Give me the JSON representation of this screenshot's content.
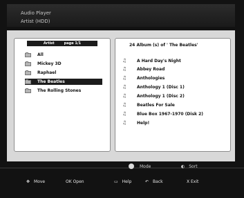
{
  "header": {
    "app_title": "Audio Player",
    "subtitle": "Artist (HDD)"
  },
  "left_panel": {
    "header_title": "Artist",
    "page_label": "page 1/1",
    "items": [
      {
        "label": "All",
        "selected": false
      },
      {
        "label": "Mickey 3D",
        "selected": false
      },
      {
        "label": "Raphael",
        "selected": false
      },
      {
        "label": "The Beatles",
        "selected": true
      },
      {
        "label": "The Rolling Stones",
        "selected": false
      }
    ]
  },
  "right_panel": {
    "header": "24 Album (s) of ' The Beatles'",
    "items": [
      "A Hard Day's Night",
      "Abbey Road",
      "Anthologies",
      "Anthology 1 (Disc 1)",
      "Anthology 1 (Disc 2)",
      "Beatles For Sale",
      "Blue Box 1967-1970 (Disk 2)",
      "Help!"
    ]
  },
  "bottom_bar": {
    "mode_label": "Mode",
    "sort_label": "Sort",
    "move_label": "Move",
    "ok_label": "OK Open",
    "help_label": "Help",
    "back_label": "Back",
    "exit_label": "X Exit"
  },
  "icons": {
    "folder": "folder-icon",
    "album": "music-note-icon",
    "mode": "mode-dot-icon",
    "sort": "sort-icon",
    "move": "dpad-icon",
    "help": "tv-help-icon",
    "back": "back-arrow-icon"
  }
}
